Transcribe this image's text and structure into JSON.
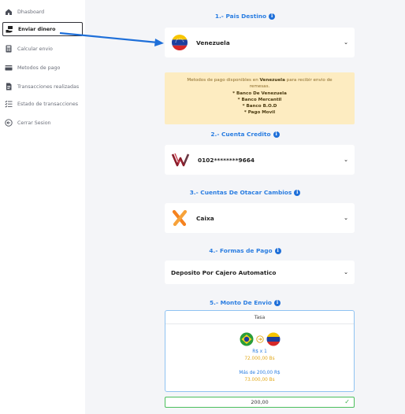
{
  "sidebar": {
    "items": [
      {
        "label": "Dhasboard",
        "icon": "house-icon"
      },
      {
        "label": "Enviar dinero",
        "icon": "money-hand-icon",
        "active": true
      },
      {
        "label": "Calcular envio",
        "icon": "calculator-icon"
      },
      {
        "label": "Metodos de pago",
        "icon": "credit-card-icon"
      },
      {
        "label": "Transacciones realizadas",
        "icon": "document-icon"
      },
      {
        "label": "Estado de transacciones",
        "icon": "list-check-icon"
      },
      {
        "label": "Cerrar Sesion",
        "icon": "logout-circle-icon"
      }
    ]
  },
  "main": {
    "pais_title": "1.- Pais Destino",
    "pais_value": "Venezuela",
    "notice": {
      "line1a": "Metodos de pago disponibles en ",
      "line1b": "Venezuela",
      "line1c": " para recibir envio de",
      "line2": "remesas.",
      "methods": [
        "* Banco De Venezuela",
        "* Banco Mercantil",
        "* Banco B.O.D",
        "* Pago Movil"
      ]
    },
    "cuenta_title": "2.- Cuenta Credito",
    "cuenta_value": "0102********9664",
    "otacar_title": "3.- Cuentas De Otacar Cambios",
    "otacar_value": "Caixa",
    "formas_title": "4.- Formas de Pago",
    "formas_value": "Deposito Por Cajero Automatico",
    "monto_title": "5.- Monto De Envio",
    "rate": {
      "head": "Tasa",
      "base": "R$ x 1",
      "base_rate": "72.000,00 Bs",
      "tier": "Más de 200,00 R$",
      "tier_rate": "73.000,00 Bs"
    },
    "amount_value": "200,00"
  },
  "colors": {
    "accent_blue": "#2a7de1",
    "notice_bg": "#fdecc1",
    "gold": "#e2a81a",
    "success_green": "#3bb04b"
  }
}
